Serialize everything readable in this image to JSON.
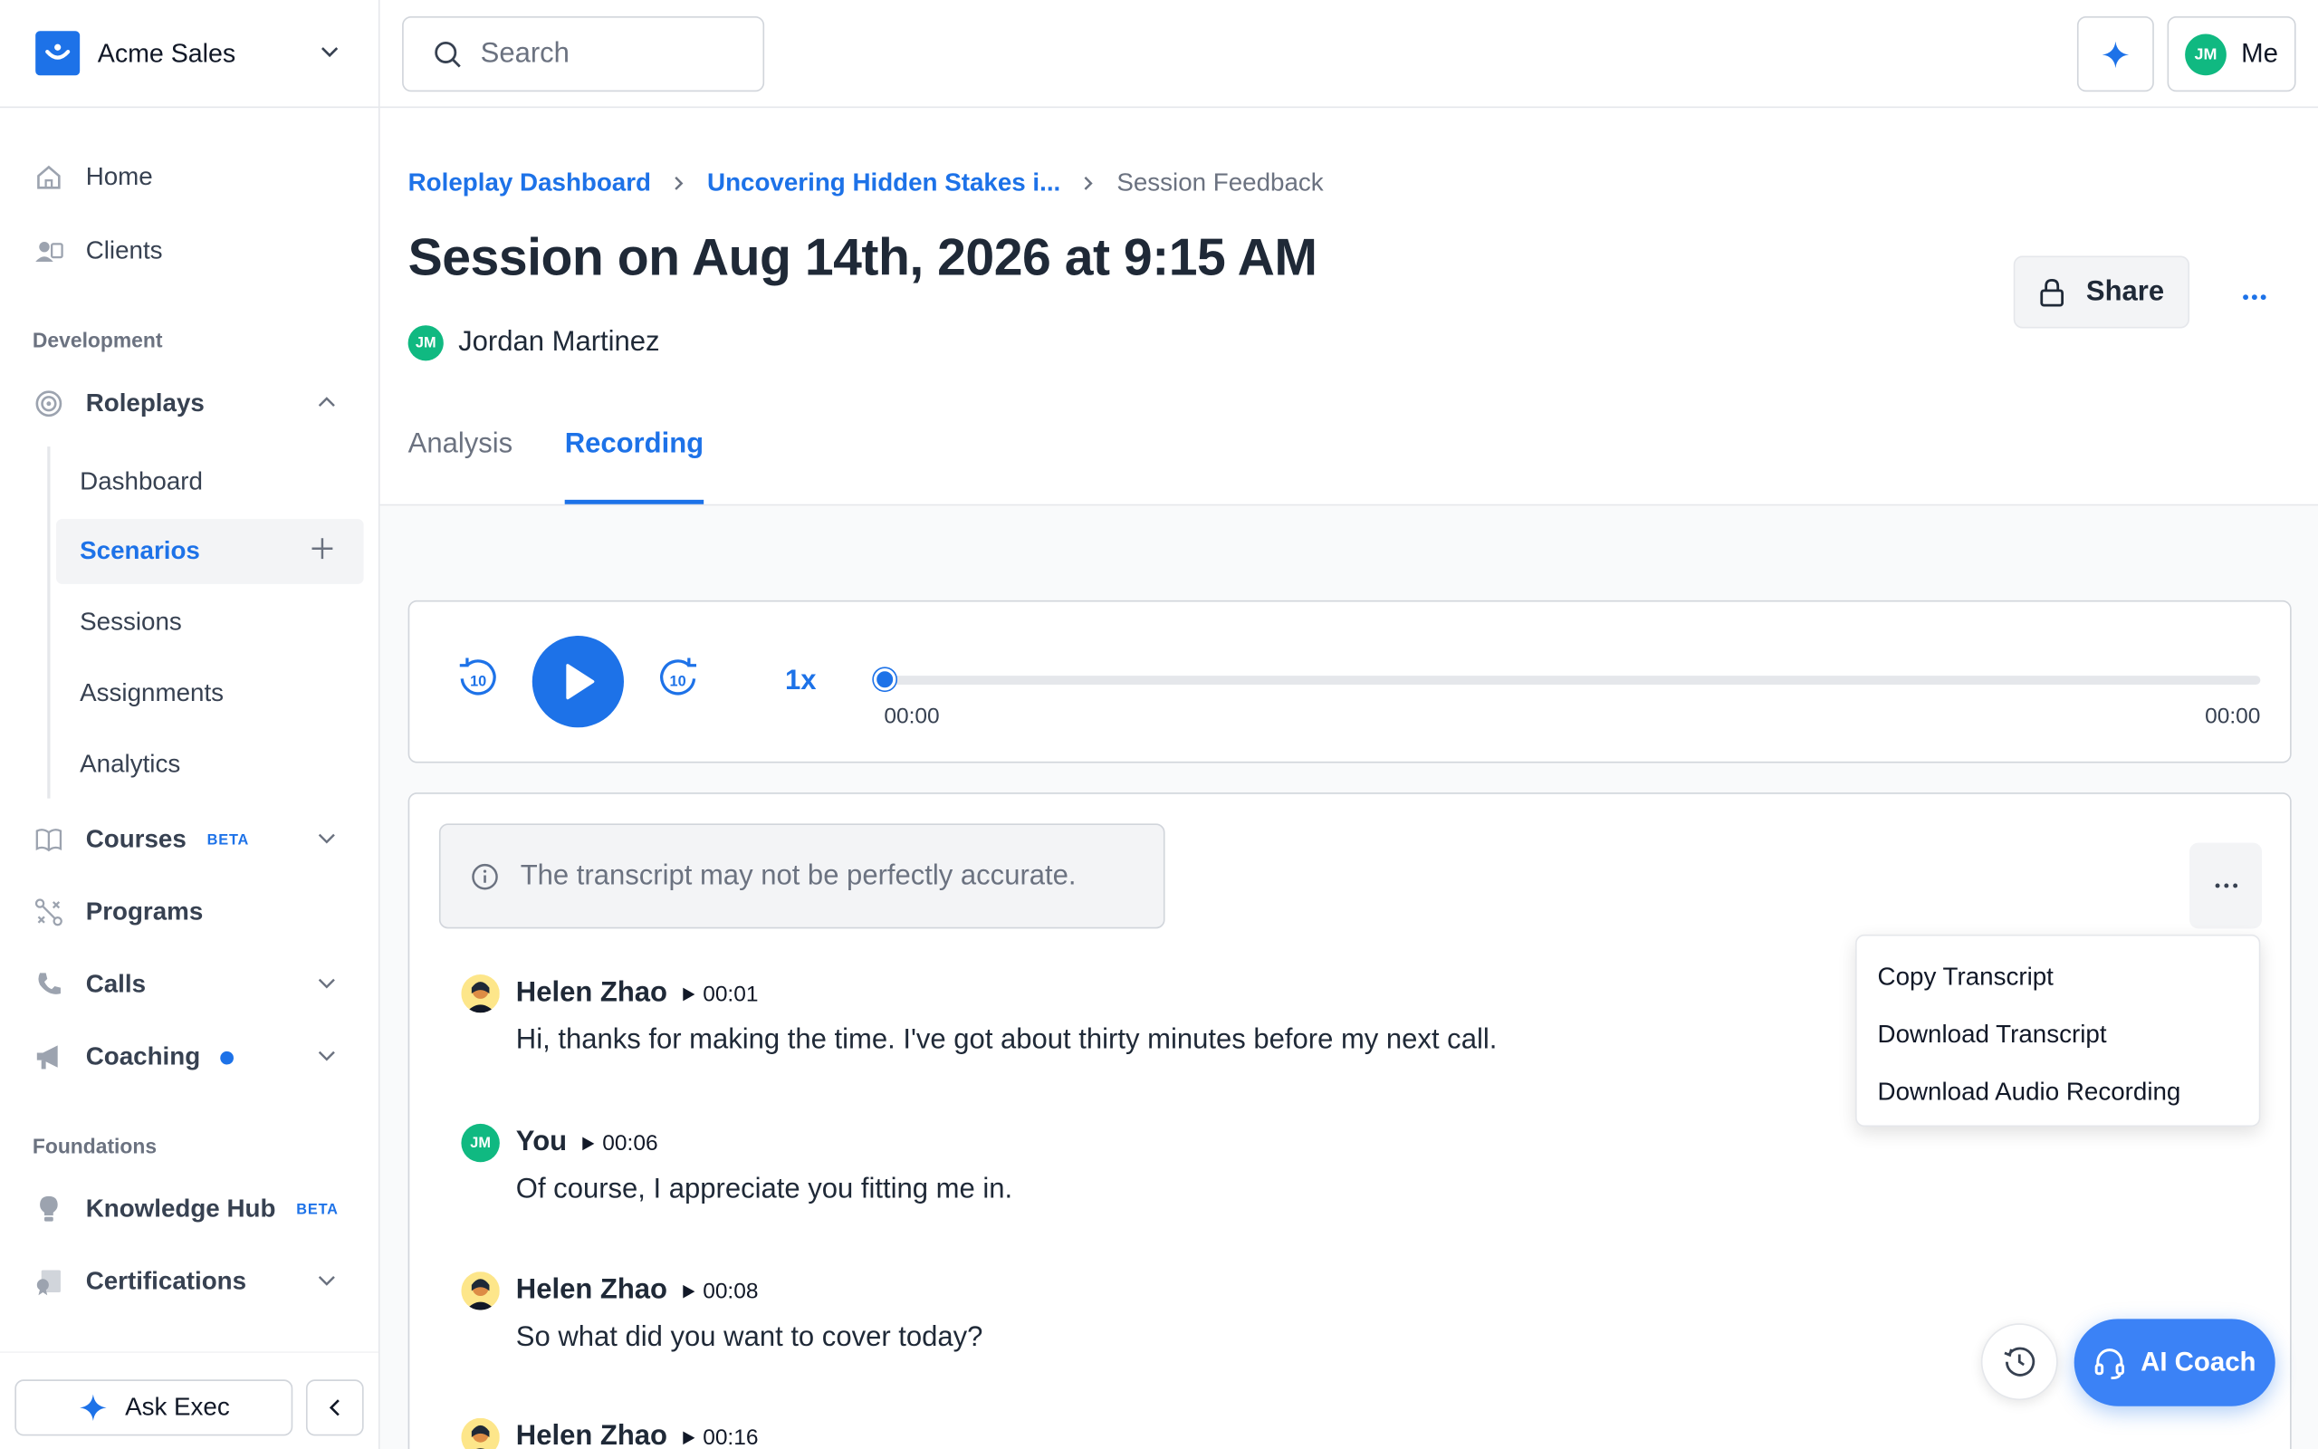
{
  "org": {
    "name": "Acme Sales"
  },
  "nav": {
    "home": "Home",
    "clients": "Clients",
    "section_development": "Development",
    "roleplays": "Roleplays",
    "roleplay_sub": [
      "Dashboard",
      "Scenarios",
      "Sessions",
      "Assignments",
      "Analytics"
    ],
    "courses": "Courses",
    "courses_badge": "BETA",
    "programs": "Programs",
    "calls": "Calls",
    "coaching": "Coaching",
    "section_foundations": "Foundations",
    "knowledge_hub": "Knowledge Hub",
    "knowledge_badge": "BETA",
    "certifications": "Certifications"
  },
  "sidebar_footer": {
    "ask": "Ask Exec"
  },
  "topbar": {
    "search_placeholder": "Search",
    "user_initials": "JM",
    "user_label": "Me"
  },
  "breadcrumb": [
    "Roleplay Dashboard",
    "Uncovering Hidden Stakes i...",
    "Session Feedback"
  ],
  "page": {
    "title": "Session on Aug 14th, 2026 at 9:15 AM",
    "owner_initials": "JM",
    "owner_name": "Jordan Martinez",
    "share": "Share"
  },
  "tabs": [
    "Analysis",
    "Recording"
  ],
  "player": {
    "speed": "1x",
    "current_time": "00:00",
    "total_time": "00:00",
    "progress": 0
  },
  "transcript": {
    "notice": "The transcript may not be perfectly accurate.",
    "menu": [
      "Copy Transcript",
      "Download Transcript",
      "Download Audio Recording"
    ],
    "messages": [
      {
        "speaker": "Helen Zhao",
        "time": "00:01",
        "text": "Hi, thanks for making the time. I've got about thirty minutes before my next call."
      },
      {
        "speaker": "You",
        "initials": "JM",
        "time": "00:06",
        "text": "Of course, I appreciate you fitting me in."
      },
      {
        "speaker": "Helen Zhao",
        "time": "00:08",
        "text": "So what did you want to cover today?"
      },
      {
        "speaker": "Helen Zhao",
        "time": "00:16",
        "text": ""
      }
    ]
  },
  "floating": {
    "coach": "AI Coach"
  },
  "colors": {
    "accent": "#1d72e8",
    "avatar_green": "#10b981"
  }
}
